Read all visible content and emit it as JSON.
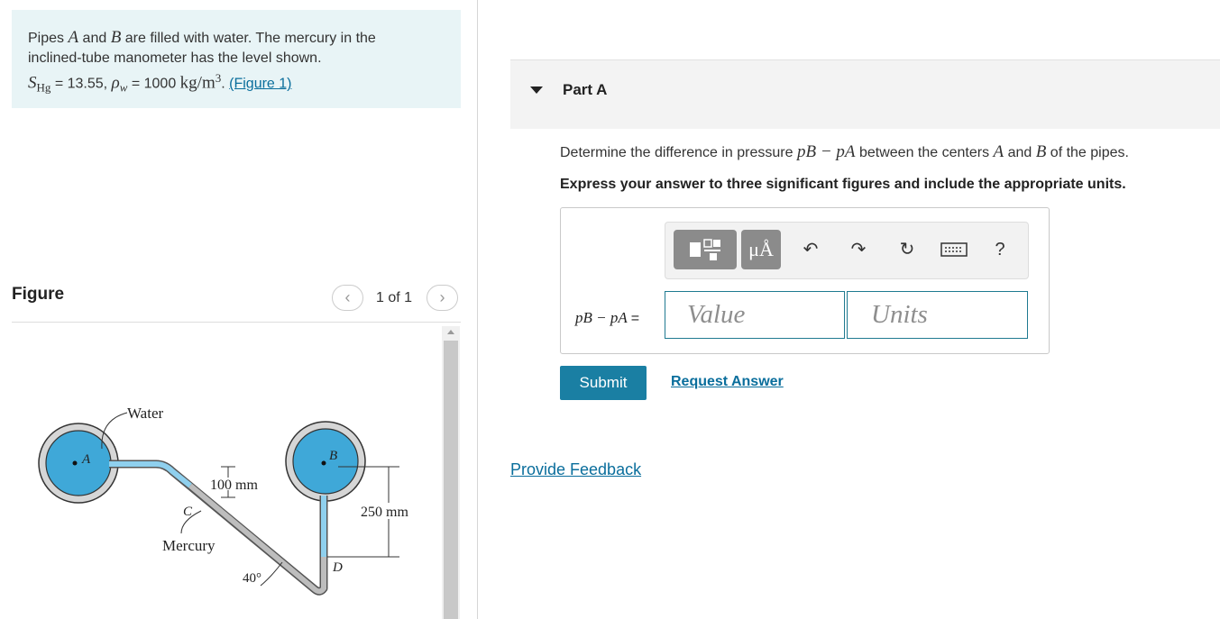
{
  "problem": {
    "text_line1": "Pipes",
    "var_a": "A",
    "text_and": "and",
    "var_b": "B",
    "text_line1_rest": "are filled with water. The mercury in the",
    "text_line2": "inclined-tube manometer has the level shown.",
    "s_hg_symbol": "S",
    "s_hg_sub": "Hg",
    "s_hg_value": "= 13.55,",
    "rho_symbol": "ρ",
    "rho_sub": "w",
    "rho_value": "= 1000",
    "rho_units": "kg/m",
    "rho_units_exp": "3",
    "period": ".",
    "figure_link": "(Figure 1)"
  },
  "figure": {
    "title": "Figure",
    "counter": "1 of 1",
    "prev_icon": "chevron-left-icon",
    "next_icon": "chevron-right-icon",
    "labels": {
      "water": "Water",
      "a": "A",
      "b": "B",
      "c": "C",
      "d": "D",
      "dim_100": "100 mm",
      "dim_250": "250 mm",
      "mercury": "Mercury",
      "angle": "40°"
    },
    "colors": {
      "pipe_fill": "#3fa8d8",
      "pipe_ring": "#d6d6d6",
      "tube_water": "#8fd0ee",
      "tube_mercury": "#bdbdbd"
    }
  },
  "part": {
    "title": "Part A",
    "question_pre": "Determine the difference in pressure",
    "question_math": "pB − pA",
    "question_post": "between the centers",
    "question_a": "A",
    "question_and": "and",
    "question_b": "B",
    "question_end": "of the pipes.",
    "instructions": "Express your answer to three significant figures and include the appropriate units."
  },
  "toolbar": {
    "templates_icon": "templates-icon",
    "units_label": "μÅ",
    "undo_icon": "undo-icon",
    "redo_icon": "redo-icon",
    "reset_icon": "reset-icon",
    "keyboard_icon": "keyboard-icon",
    "help_label": "?"
  },
  "answer": {
    "label": "pB − pA",
    "equals": "=",
    "value_placeholder": "Value",
    "units_placeholder": "Units"
  },
  "actions": {
    "submit": "Submit",
    "request_answer": "Request Answer",
    "provide_feedback": "Provide Feedback"
  },
  "colors": {
    "accent": "#1a7fa3",
    "link": "#0a6e9c",
    "problem_bg": "#e8f4f6"
  }
}
